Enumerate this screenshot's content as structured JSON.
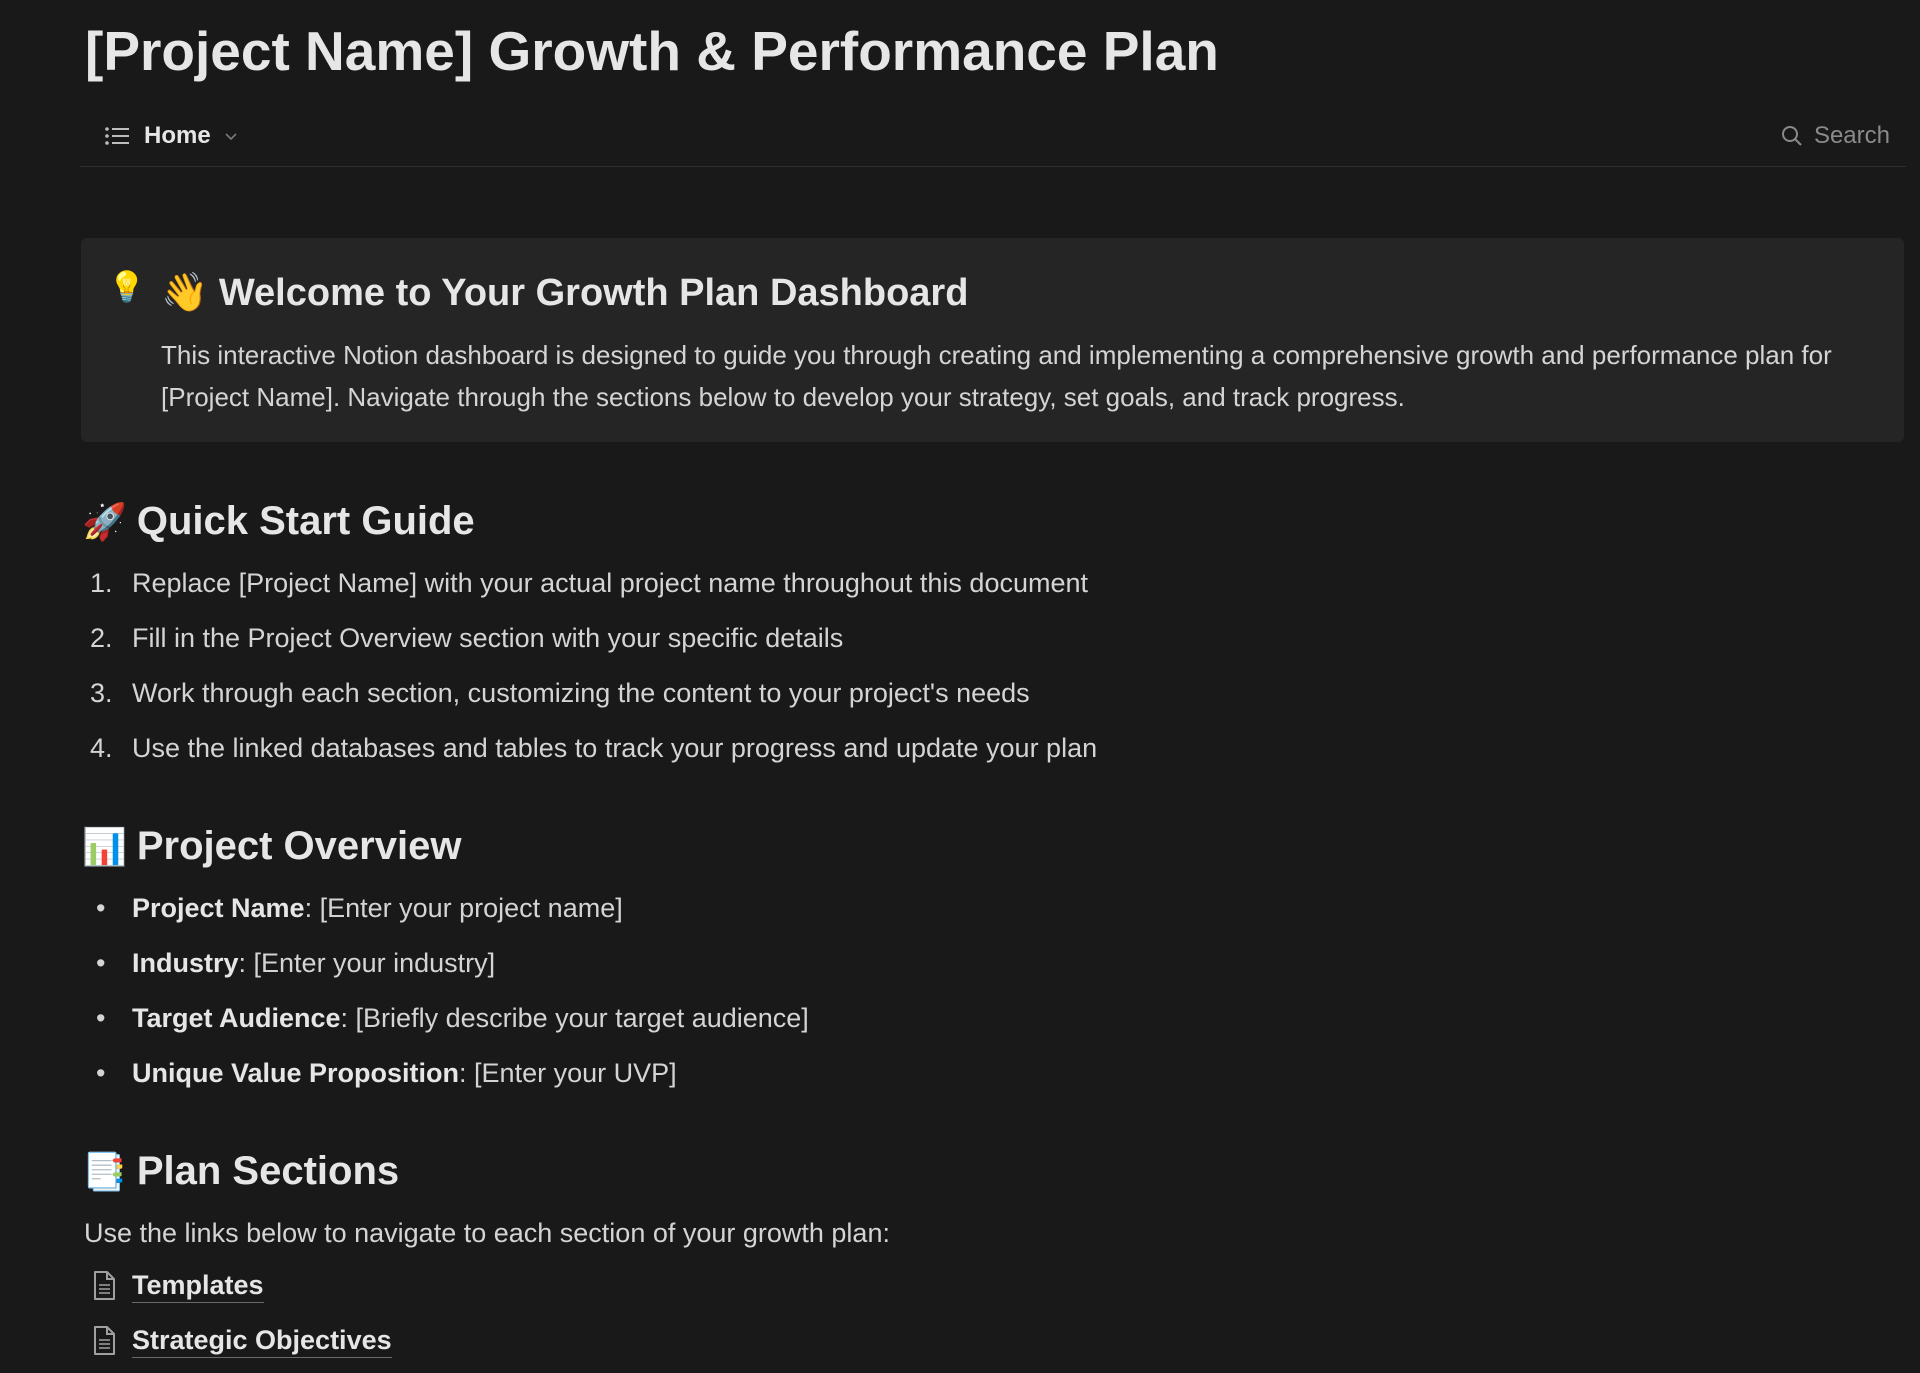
{
  "page": {
    "title": "[Project Name] Growth & Performance Plan"
  },
  "nav": {
    "home_label": "Home",
    "search_label": "Search"
  },
  "callout": {
    "icon": "💡",
    "heading": "👋 Welcome to Your Growth Plan Dashboard",
    "body": "This interactive Notion dashboard is designed to guide you through creating and implementing a comprehensive growth and performance plan for [Project Name]. Navigate through the sections below to develop your strategy, set goals, and track progress."
  },
  "quick_start": {
    "emoji": "🚀",
    "heading": "Quick Start Guide",
    "items": [
      {
        "num": "1.",
        "text": "Replace [Project Name] with your actual project name throughout this document"
      },
      {
        "num": "2.",
        "text": "Fill in the Project Overview section with your specific details"
      },
      {
        "num": "3.",
        "text": "Work through each section, customizing the content to your project's needs"
      },
      {
        "num": "4.",
        "text": "Use the linked databases and tables to track your progress and update your plan"
      }
    ]
  },
  "overview": {
    "emoji": "📊",
    "heading": "Project Overview",
    "items": [
      {
        "label": "Project Name",
        "value": ": [Enter your project name]"
      },
      {
        "label": "Industry",
        "value": ": [Enter your industry]"
      },
      {
        "label": "Target Audience",
        "value": ": [Briefly describe your target audience]"
      },
      {
        "label": "Unique Value Proposition",
        "value": ": [Enter your UVP]"
      }
    ]
  },
  "plan_sections": {
    "emoji": "📑",
    "heading": "Plan Sections",
    "intro": "Use the links below to navigate to each section of your growth plan:",
    "links": [
      "Templates",
      "Strategic Objectives"
    ]
  },
  "colors": {
    "background": "#191919",
    "callout_bg": "#252525",
    "text": "#d4d4d4",
    "heading": "#e6e6e6",
    "muted": "#8a8a8a"
  }
}
